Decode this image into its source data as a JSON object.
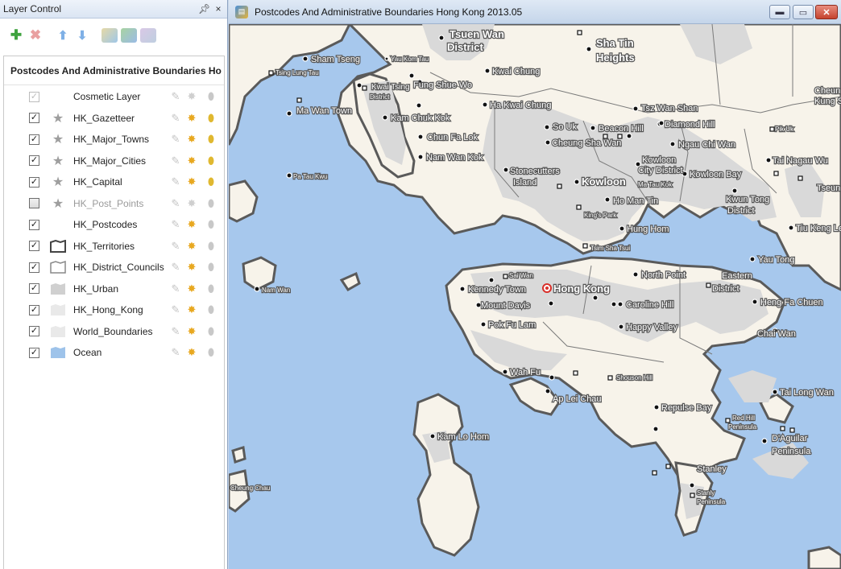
{
  "panel": {
    "title": "Layer Control",
    "pin_icon": "pin-icon",
    "close_icon": "close-icon",
    "toolbar": {
      "add_icon": "add-layer-icon",
      "remove_icon": "remove-layer-icon",
      "up_icon": "move-up-icon",
      "down_icon": "move-down-icon",
      "tool1_icon": "layer-properties-icon",
      "tool2_icon": "layer-style-icon",
      "tool3_icon": "layer-label-icon"
    },
    "map_title": "Postcodes And Administrative Boundaries Ho",
    "layers": [
      {
        "name": "Cosmetic Layer",
        "checked": true,
        "dim_check": true,
        "symbol": "none",
        "label": false,
        "name_dim": false,
        "wand": false
      },
      {
        "name": "HK_Gazetteer",
        "checked": true,
        "symbol": "star",
        "label": true,
        "wand": true
      },
      {
        "name": "HK_Major_Towns",
        "checked": true,
        "symbol": "star",
        "label": true,
        "wand": true
      },
      {
        "name": "HK_Major_Cities",
        "checked": true,
        "symbol": "star",
        "label": true,
        "wand": true
      },
      {
        "name": "HK_Capital",
        "checked": true,
        "symbol": "star",
        "label": true,
        "wand": true
      },
      {
        "name": "HK_Post_Points",
        "checked": false,
        "symbol": "star",
        "label": false,
        "name_dim": true,
        "wand": false
      },
      {
        "name": "HK_Postcodes",
        "checked": true,
        "symbol": "none",
        "label": false,
        "wand": true
      },
      {
        "name": "HK_Territories",
        "checked": true,
        "symbol": "polygon-dark",
        "label": false,
        "wand": true
      },
      {
        "name": "HK_District_Councils",
        "checked": true,
        "symbol": "polygon-light",
        "label": false,
        "wand": true
      },
      {
        "name": "HK_Urban",
        "checked": true,
        "symbol": "fill-grey",
        "label": false,
        "wand": true
      },
      {
        "name": "HK_Hong_Kong",
        "checked": true,
        "symbol": "fill-light",
        "label": false,
        "wand": true
      },
      {
        "name": "World_Boundaries",
        "checked": true,
        "symbol": "fill-light",
        "label": false,
        "wand": true
      },
      {
        "name": "Ocean",
        "checked": true,
        "symbol": "fill-blue",
        "label": false,
        "wand": true
      }
    ]
  },
  "mapwindow": {
    "title": "Postcodes And Administrative Boundaries Hong Kong 2013.05",
    "app_icon": "map-app-icon",
    "min_icon": "minimize-icon",
    "max_icon": "maximize-icon",
    "close_icon": "close-icon",
    "colors": {
      "ocean": "#a7c8ed",
      "land": "#f7f3ea",
      "urban": "#d9d9d9",
      "border": "#5a5a5a"
    },
    "labels": {
      "tsuen_wan": "Tsuen Wan",
      "district": "District",
      "sha_tin": "Sha Tin",
      "heights": "Heights",
      "sham_tseng": "Sham Tseng",
      "yau_kom_tau": "Yau Kom Tau",
      "tsing_lung_tau": "Tsing Lung Tau",
      "kwai_chung": "Kwai Chung",
      "kwai_tsing": "Kwai Tsing",
      "kwai_tsing_district": "District",
      "fung_shue_wo": "Fung Shue Wo",
      "ma_wan_town": "Ma Wan Town",
      "ha_kwai_chung": "Ha Kwai Chung",
      "kam_chuk_kok": "Kam Chuk Kok",
      "tsz_wan_shan": "Tsz Wan Shan",
      "cheung_kung_shan": "Cheun",
      "kung_s": "Kung S",
      "so_uk": "So Uk",
      "beacon_hill": "Beacon Hill",
      "diamond_hill": "Diamond Hill",
      "pik_uk": "Pik Uk",
      "chun_fa_lok": "Chun Fa Lok",
      "cheung_sha_wan": "Cheung Sha Wan",
      "ngau_chi_wan": "Ngau Chi Wan",
      "nam_wan_kok": "Nam Wan Kok",
      "kowloon_city": "Kowloon",
      "city_district": "City District",
      "tai_nagau_wu": "Tai Nagau Wu",
      "pa_tau_kwu": "Pa Tau Kwu",
      "stonecutters": "Stonecutters",
      "island": "Island",
      "kowloon": "Kowloon",
      "ma_tau_kok": "Ma Tau Kok",
      "kowloon_bay": "Kowloon Bay",
      "tseun": "Tseun",
      "ho_man_tin": "Ho Man Tin",
      "kwun_tong": "Kwun Tong",
      "kwun_tong_district": "District",
      "kings_park": "King's Park",
      "hung_hom": "Hung Hom",
      "tiu_keng_le": "Tiu Keng Le",
      "tsim_sha_tsui": "Tsim Sha Tsui",
      "yau_tong": "Yau Tong",
      "sai_wan": "Sai Wan",
      "north_point": "North Point",
      "eastern": "Eastern",
      "eastern_district": "District",
      "nam_wan": "Nam Wan",
      "kennedy_town": "Kennedy Town",
      "hong_kong": "Hong Kong",
      "mount_davis": "Mount Davis",
      "caroline_hill": "Caroline Hill",
      "heng_fa_chuen": "Heng Fa Chuen",
      "pok_fu_lam": "Pok Fu Lam",
      "happy_valley": "Happy Valley",
      "chai_wan": "Chai Wan",
      "wah_fu": "Wah Fu",
      "shouson_hill": "Shouson Hill",
      "tai_long_wan": "Tai Long Wan",
      "ap_lei_chau": "Ap Lei Chau",
      "repulse_bay": "Repulse Bay",
      "red_hill": "Red Hill",
      "red_hill_pen": "Peninsula",
      "kam_lo_hom": "Kam Lo Hom",
      "d_aguilar": "D'Aguilar",
      "d_aguilar_pen": "Peninsula",
      "stanley": "Stanley",
      "cheung_chau": "Cheung Chau",
      "stanly": "Stanly",
      "stanly_pen": "Peninsula"
    }
  }
}
